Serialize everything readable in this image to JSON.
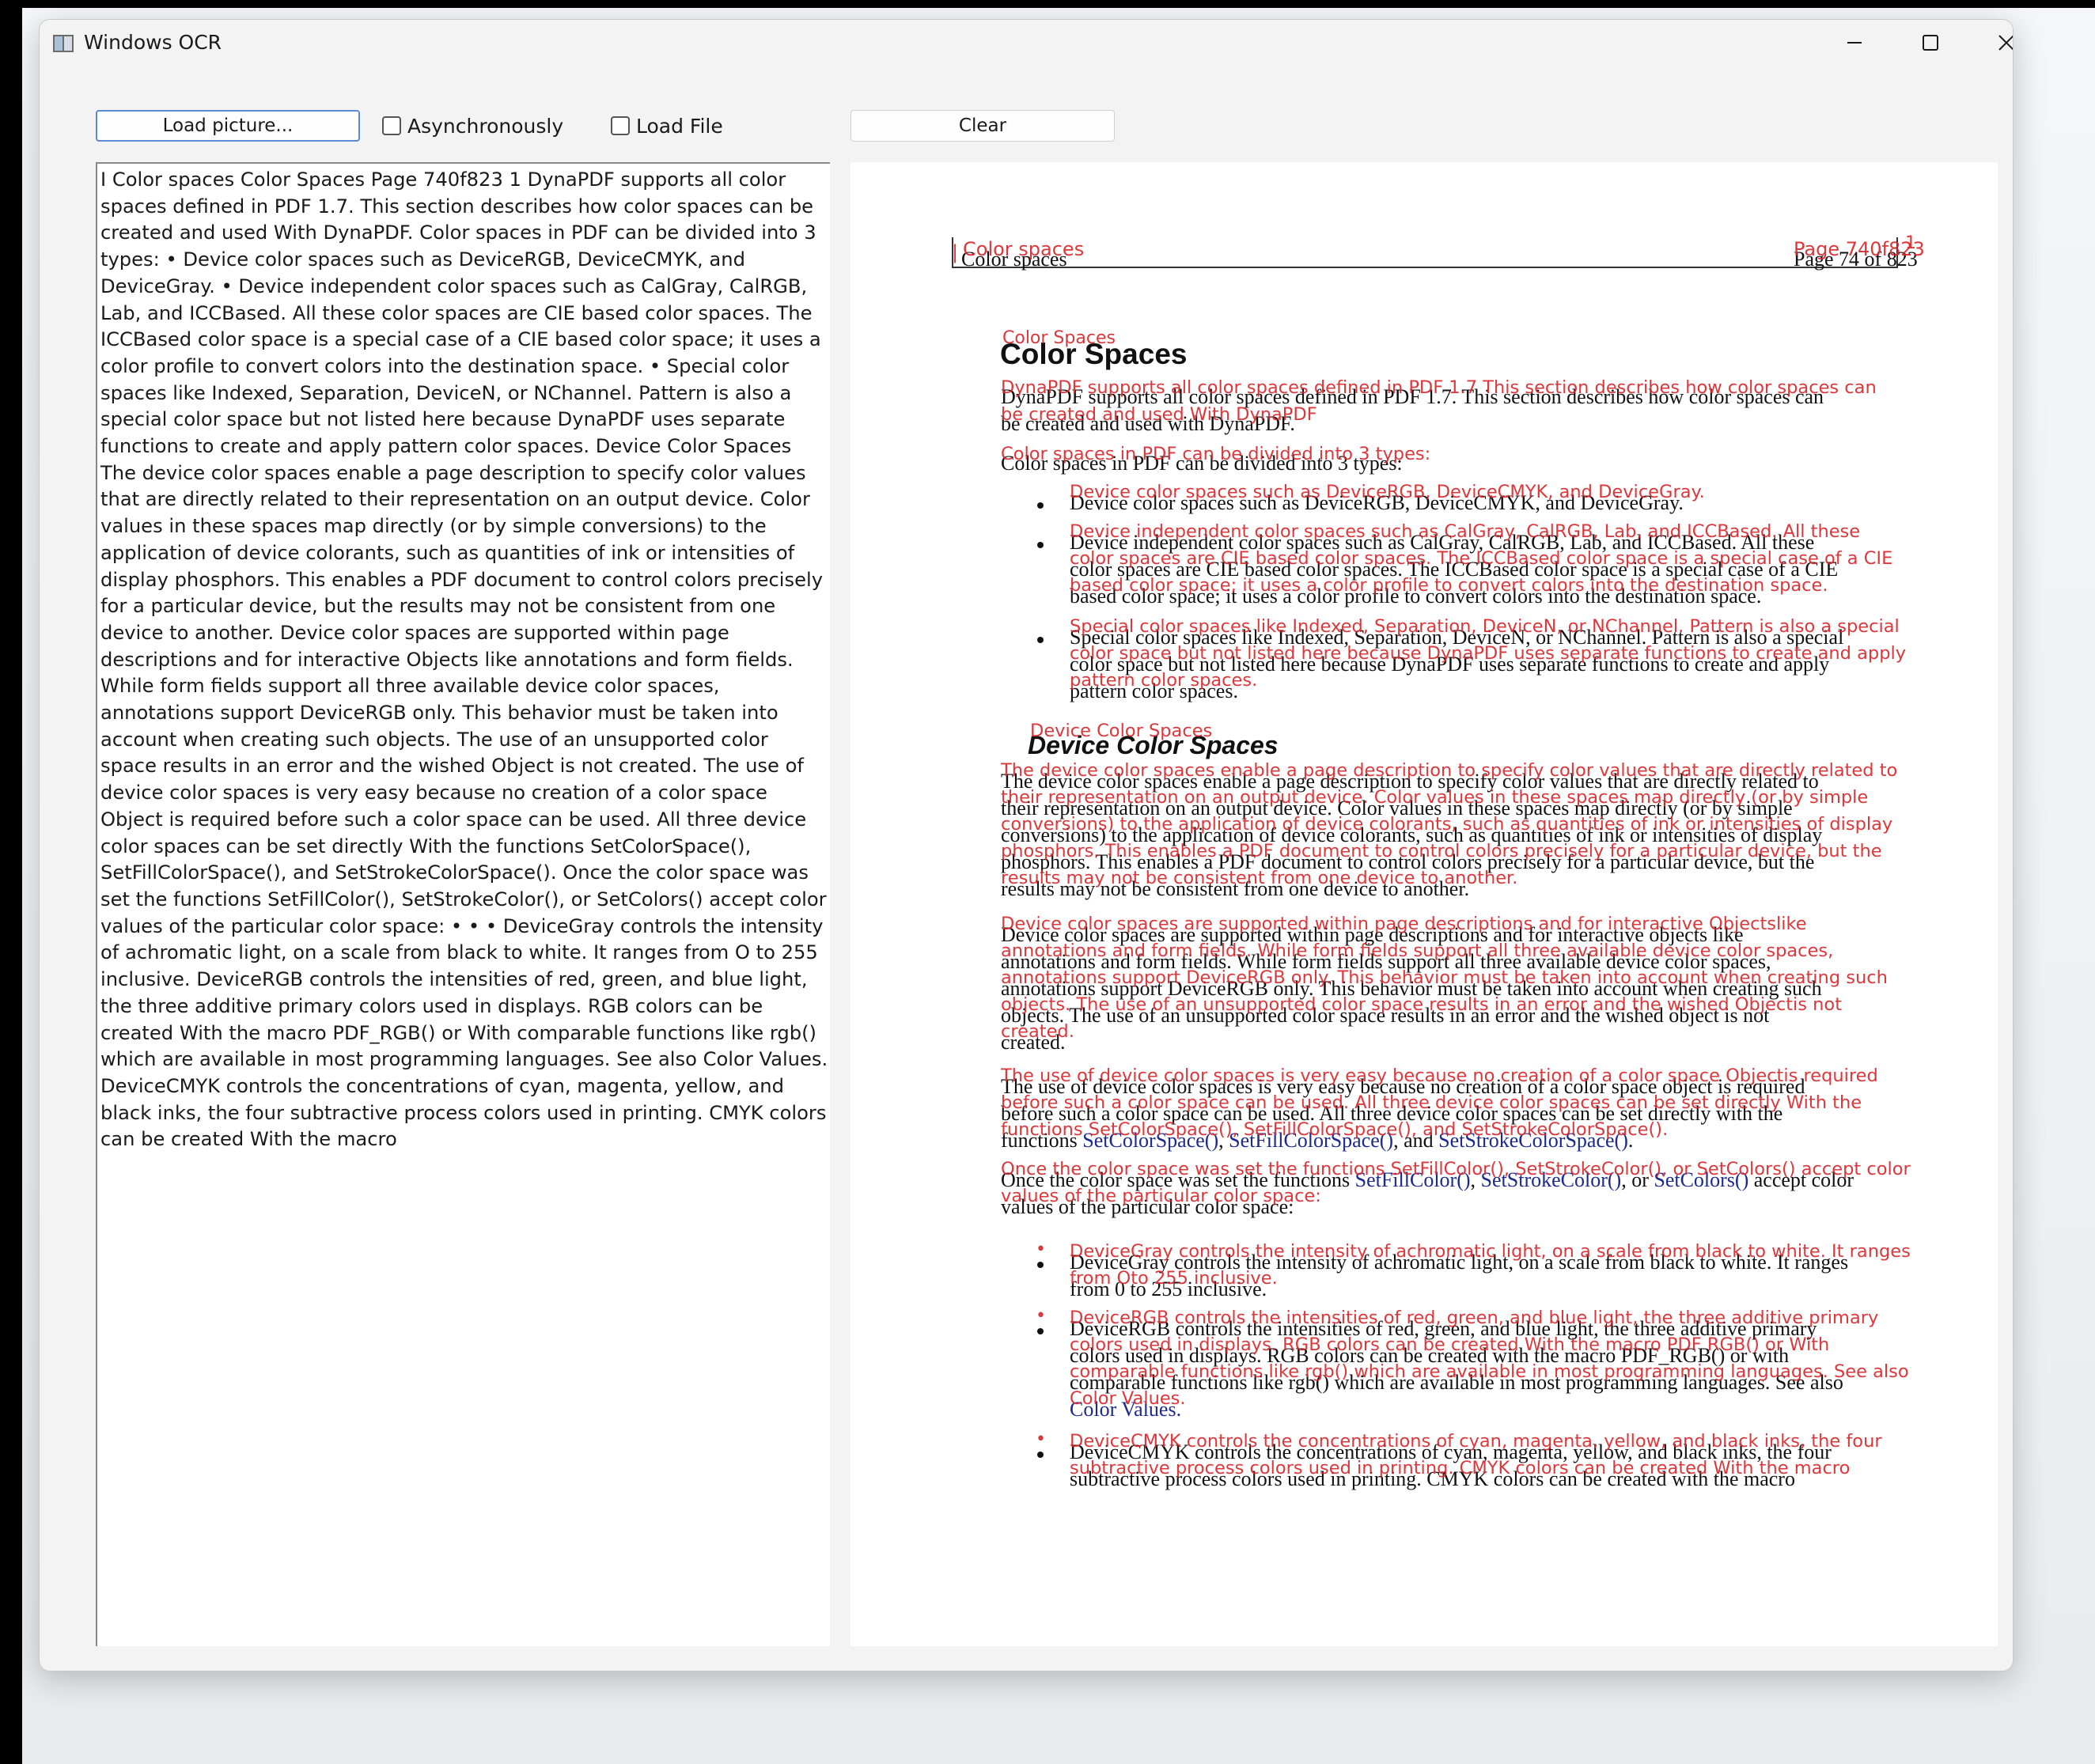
{
  "window": {
    "title": "Windows OCR",
    "icons": {
      "app": "app-window-icon",
      "minimize": "minimize-icon",
      "maximize": "maximize-icon",
      "close": "close-icon"
    }
  },
  "toolbar": {
    "load_picture": "Load picture...",
    "async_label": "Asynchronously",
    "async_checked": false,
    "load_file_label": "Load File",
    "load_file_checked": false,
    "clear": "Clear"
  },
  "ocr_text": "I Color spaces Color Spaces Page 740f823 1 DynaPDF supports all color spaces defined in PDF 1.7. This section describes how color spaces can be created and used With DynaPDF. Color spaces in PDF can be divided into 3 types: • Device color spaces such as DeviceRGB, DeviceCMYK, and DeviceGray. • Device independent color spaces such as CalGray, CalRGB, Lab, and ICCBased. All these color spaces are CIE based color spaces. The ICCBased color space is a special case of a CIE based color space; it uses a color profile to convert colors into the destination space. • Special color spaces like Indexed, Separation, DeviceN, or NChannel. Pattern is also a special color space but not listed here because DynaPDF uses separate functions to create and apply pattern color spaces. Device Color Spaces The device color spaces enable a page description to specify color values that are directly related to their representation on an output device. Color values in these spaces map directly (or by simple conversions) to the application of device colorants, such as quantities of ink or intensities of display phosphors. This enables a PDF document to control colors precisely for a particular device, but the results may not be consistent from one device to another. Device color spaces are supported within page descriptions and for interactive Objects like annotations and form fields. While form fields support all three available device color spaces, annotations support DeviceRGB only. This behavior must be taken into account when creating such objects. The use of an unsupported color space results in an error and the wished Object is not created. The use of device color spaces is very easy because no creation of a color space Object is required before such a color space can be used. All three device color spaces can be set directly With the functions SetColorSpace(), SetFillColorSpace(), and SetStrokeColorSpace(). Once the color space was set the functions SetFillColor(), SetStrokeColor(), or SetColors() accept color values of the particular color space: • • • DeviceGray controls the intensity of achromatic light, on a scale from black to white. It ranges from O to 255 inclusive. DeviceRGB controls the intensities of red, green, and blue light, the three additive primary colors used in displays. RGB colors can be created With the macro PDF_RGB() or With comparable functions like rgb() which are available in most programming languages. See also Color Values. DeviceCMYK controls the concentrations of cyan, magenta, yellow, and black inks, the four subtractive process colors used in printing. CMYK colors can be created With the macro",
  "page": {
    "header_left": "Color spaces",
    "header_right": "Page 74 of 823",
    "h1": "Color Spaces",
    "intro1": "DynaPDF supports all color spaces defined in PDF 1.7. This section describes how color spaces can",
    "intro2": "be created and used with DynaPDF.",
    "types": "Color spaces in PDF can be divided into 3 types:",
    "b1": "Device color spaces such as DeviceRGB, DeviceCMYK, and DeviceGray.",
    "b2_1": "Device independent color spaces such as CalGray, CalRGB, Lab, and ICCBased. All these",
    "b2_2": "color spaces are CIE based color spaces. The ICCBased color space is a special case of a CIE",
    "b2_3": "based color space; it uses a color profile to convert colors into the destination space.",
    "b3_1": "Special color spaces like Indexed, Separation, DeviceN, or NChannel. Pattern is also a special",
    "b3_2": "color space but not listed here because DynaPDF uses separate functions to create and apply",
    "b3_3": "pattern color spaces.",
    "h2": "Device Color Spaces",
    "p1_1": "The device color spaces enable a page description to specify color values that are directly related to",
    "p1_2": "their representation on an output device. Color values in these spaces map directly (or by simple",
    "p1_3": "conversions) to the application of device colorants, such as quantities of ink or intensities of display",
    "p1_4": "phosphors. This enables a PDF document to control colors precisely for a particular device, but the",
    "p1_5": "results may not be consistent from one device to another.",
    "p2_1": "Device color spaces are supported within page descriptions and for interactive objects like",
    "p2_2": "annotations and form fields. While form fields support all three available device color spaces,",
    "p2_3": "annotations support DeviceRGB only. This behavior must be taken into account when creating such",
    "p2_4": "objects. The use of an unsupported color space results in an error and the wished object is not",
    "p2_5": "created.",
    "p3_1": "The use of device color spaces is very easy because no creation of a color space object is required",
    "p3_2": "before such a color space can be used. All three device color spaces can be set directly with the",
    "p3_3a": "functions ",
    "p3_3b": "SetColorSpace()",
    "p3_3c": ", ",
    "p3_3d": "SetFillColorSpace()",
    "p3_3e": ", and ",
    "p3_3f": "SetStrokeColorSpace()",
    "p3_3g": ".",
    "p4_1a": "Once the color space was set the functions ",
    "p4_1b": "SetFillColor()",
    "p4_1c": ", ",
    "p4_1d": "SetStrokeColor()",
    "p4_1e": ", or ",
    "p4_1f": "SetColors()",
    "p4_1g": " accept color",
    "p4_2": "values of the particular color space:",
    "g1": "DeviceGray controls the intensity of achromatic light, on a scale from black to white. It ranges",
    "g2": "from 0 to 255 inclusive.",
    "r1": "DeviceRGB controls the intensities of red, green, and blue light, the three additive primary",
    "r2": "colors used in displays. RGB colors can be created with the macro PDF_RGB() or with",
    "r3": "comparable functions like rgb() which are available in most programming languages. See also",
    "r4": "Color Values.",
    "c1": "DeviceCMYK controls the concentrations of cyan, magenta, yellow, and black inks, the four",
    "c2": "subtractive process colors used in printing. CMYK colors can be created with the macro"
  },
  "overlay": {
    "o_hl1": "Color spaces",
    "o_hr1": "Page 740f823",
    "o_bar": "|",
    "o_one": "1",
    "o_h1": "Color      Spaces",
    "o_i1": "DynaPDF  supports  all color  spaces  defined in PDF  1.7  This  section describes how  color  spaces can",
    "o_i2": "be created and used With DynaPDF",
    "o_t": "Color    spaces   in PDF   can be divided  into 3 types:",
    "o_b1": "Device  color   spaces  such  as  DeviceRGB,  DeviceCMYK,   and DeviceGray.",
    "o_b2_1": "Device  independent color   spaces   such  as   CalGray,   CalRGB,  Lab,  and ICCBased.  All  these",
    "o_b2_2": "color   spaces are  CIE  based color  spaces.  The ICCBased  color   space is a special  case of a CIE",
    "o_b2_3": "based color   space; it uses a color profile  to convert colors into the destination  space.",
    "o_b3_1": "Special color  spaces  like Indexed,  Separation,  DeviceN,  or  NChannel.  Pattern  is also a special",
    "o_b3_2": "color  space but not listed here because DynaPDF  uses separate functions  to create and apply",
    "o_b3_3": "pattern color spaces.",
    "o_h2": "Device      Color      Spaces",
    "o_p1_1": "The device color  spaces enable  a page description  to specify  color values  that  are  directly  related to",
    "o_p1_2": "their representation  on an  output device.  Color values  in these  spaces map  directly  (or by simple",
    "o_p1_3": "conversions)  to the application  of device colorants,  such  as  quantities of ink  or  intensities of display",
    "o_p1_4": "phosphors.  This  enables  a  PDF document to control colors  precisely  for  a  particular  device,  but the",
    "o_p1_5": "results  may  not be consistent  from  one device to another.",
    "o_p2_1": "Device  color   spaces are   supported  within   page  descriptions  and for interactive  Objectslike",
    "o_p2_2": "annotations and form  fields.  While  form  fields  support all three available  device color  spaces,",
    "o_p2_3": "annotations  support  DeviceRGB   only.  This  behavior  must  be taken into account  when  creating  such",
    "o_p2_4": "objects.  The  use of  an  unsupported  color  space results  in  an  error  and the wished  Objectis not",
    "o_p2_5": "created.",
    "o_p3_1": "The  use  of device color  spaces is very  easy  because  no  creation  of a  color  space  Objectis required",
    "o_p3_2": "before such  a  color  space can  be used.  All three device color  spaces can  be set directly  With the",
    "o_p3_3": "functions  SetColorSpace(),   SetFillColorSpace(),    and   SetStrokeColorSpace().",
    "o_p4_1": "Once the color  space was  set the functions  SetFillColor(),    SetStrokeColor(),    or   SetColors()   accept color",
    "o_p4_2": "values  of the particular  color   space:",
    "o_g1": "DeviceGray   controls  the intensity  of achromatic  light,   on  a  scale from black  to white.  It  ranges",
    "o_g2": "from Oto 255 inclusive.",
    "o_r1": "DeviceRGB   controls  the intensities  of red,   green,  and blue light,  the three additive  primary",
    "o_r2": "colors used  in displays.  RGB  colors  can be created With the macro   PDF  RGB()   or  With",
    "o_r3": "comparable  functions  like rgb()  which   are  available  in most programming   languages.  See also",
    "o_r4": "Color Values.",
    "o_c1": "DeviceCMYK    controls  the concentrations  of   cyan,   magenta,  yellow,  and black inks,  the four",
    "o_c2": "subtractive   process  colors  used  in printing.   CMYK   colors   can  be created With the macro",
    "o_dot": "•"
  },
  "colors": {
    "overlay_red": "#d9292e",
    "link_blue": "#1c2a8e",
    "focus_border": "#5b8ad8"
  }
}
